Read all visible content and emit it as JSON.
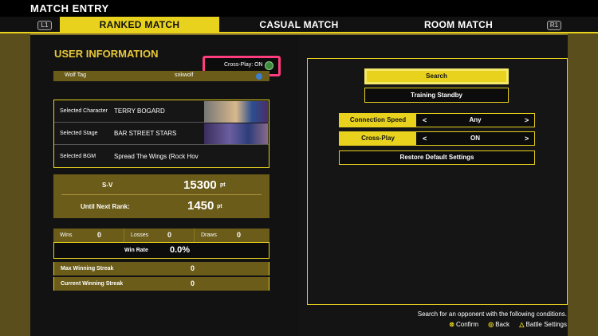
{
  "window": {
    "title": "MATCH ENTRY"
  },
  "tabs": {
    "left_key": "L1",
    "right_key": "R1",
    "items": [
      {
        "label": "RANKED MATCH",
        "active": true
      },
      {
        "label": "CASUAL MATCH",
        "active": false
      },
      {
        "label": "ROOM MATCH",
        "active": false
      }
    ]
  },
  "user_info": {
    "title": "USER INFORMATION",
    "crossplay_status": "Cross-Play: ON",
    "wolf_tag_label": "Wolf Tag",
    "wolf_tag_value": "snkwolf",
    "selections": [
      {
        "label": "Selected Character",
        "value": "TERRY BOGARD"
      },
      {
        "label": "Selected Stage",
        "value": "BAR STREET STARS"
      },
      {
        "label": "Selected BGM",
        "value": "Spread The Wings (Rock Hov"
      }
    ],
    "sv_label": "S-V",
    "sv_value": "15300",
    "sv_unit": "pt",
    "next_rank_label": "Until Next Rank:",
    "next_rank_value": "1450",
    "next_rank_unit": "pt",
    "record": {
      "wins_label": "Wins",
      "wins_value": "0",
      "losses_label": "Losses",
      "losses_value": "0",
      "draws_label": "Draws",
      "draws_value": "0"
    },
    "win_rate_label": "Win Rate",
    "win_rate_value": "0.0%",
    "max_streak_label": "Max Winning Streak",
    "max_streak_value": "0",
    "current_streak_label": "Current Winning Streak",
    "current_streak_value": "0"
  },
  "search_panel": {
    "search_button": "Search",
    "training_button": "Training Standby",
    "connection_speed_label": "Connection Speed",
    "connection_speed_value": "Any",
    "crossplay_label": "Cross-Play",
    "crossplay_value": "ON",
    "restore_button": "Restore Default Settings",
    "arrow_left": "<",
    "arrow_right": ">"
  },
  "footer": {
    "hint": "Search for an opponent with the following conditions.",
    "confirm": "Confirm",
    "back": "Back",
    "battle_settings": "Battle Settings",
    "confirm_glyph": "⊗",
    "back_glyph": "◎",
    "battle_glyph": "△"
  },
  "icons": {
    "globe": "globe-icon",
    "wolf_tag": "wolf-tag-icon",
    "cross_button": "cross-button-icon",
    "circle_button": "circle-button-icon",
    "triangle_button": "triangle-button-icon"
  },
  "colors": {
    "accent_yellow": "#e8d21d",
    "highlight_pink": "#ff3c7e",
    "panel_gold": "#6b5c19"
  }
}
